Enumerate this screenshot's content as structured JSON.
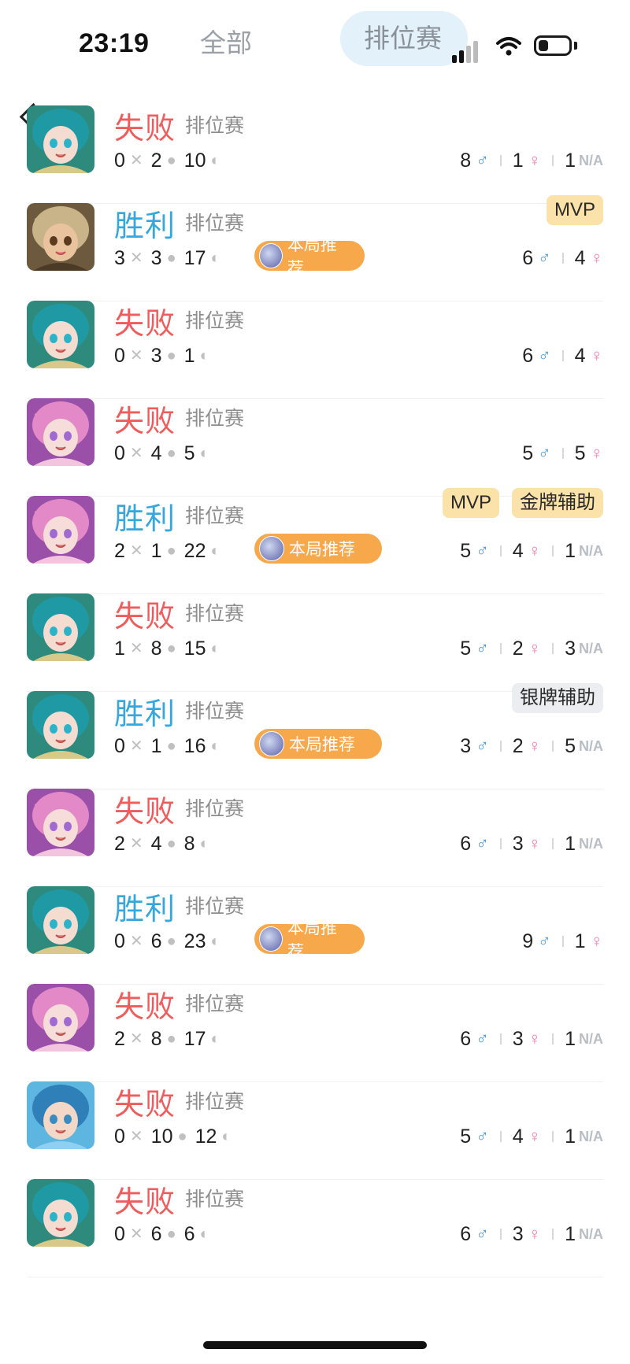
{
  "status_bar": {
    "time": "23:19"
  },
  "tabs": {
    "all": "全部",
    "ranked": "排位赛"
  },
  "colors": {
    "lose": "#ef5c5c",
    "win": "#35a7df",
    "recommend": "#f7a84a",
    "male": "#4a9ae0",
    "female": "#f07aa8"
  },
  "matches": [
    {
      "result": "失败",
      "mode": "排位赛",
      "kills": "0",
      "deaths": "2",
      "assists": "10",
      "male": "8",
      "female": "1",
      "na": "1",
      "badges": [],
      "recommend": ""
    },
    {
      "result": "胜利",
      "mode": "排位赛",
      "kills": "3",
      "deaths": "3",
      "assists": "17",
      "male": "6",
      "female": "4",
      "na": "",
      "badges": [
        "MVP"
      ],
      "recommend": "本局推荐"
    },
    {
      "result": "失败",
      "mode": "排位赛",
      "kills": "0",
      "deaths": "3",
      "assists": "1",
      "male": "6",
      "female": "4",
      "na": "",
      "badges": [],
      "recommend": ""
    },
    {
      "result": "失败",
      "mode": "排位赛",
      "kills": "0",
      "deaths": "4",
      "assists": "5",
      "male": "5",
      "female": "5",
      "na": "",
      "badges": [],
      "recommend": ""
    },
    {
      "result": "胜利",
      "mode": "排位赛",
      "kills": "2",
      "deaths": "1",
      "assists": "22",
      "male": "5",
      "female": "4",
      "na": "1",
      "badges": [
        "MVP",
        "金牌辅助"
      ],
      "recommend": "本局推荐"
    },
    {
      "result": "失败",
      "mode": "排位赛",
      "kills": "1",
      "deaths": "8",
      "assists": "15",
      "male": "5",
      "female": "2",
      "na": "3",
      "badges": [],
      "recommend": ""
    },
    {
      "result": "胜利",
      "mode": "排位赛",
      "kills": "0",
      "deaths": "1",
      "assists": "16",
      "male": "3",
      "female": "2",
      "na": "5",
      "badges": [
        "银牌辅助"
      ],
      "recommend": "本局推荐"
    },
    {
      "result": "失败",
      "mode": "排位赛",
      "kills": "2",
      "deaths": "4",
      "assists": "8",
      "male": "6",
      "female": "3",
      "na": "1",
      "badges": [],
      "recommend": ""
    },
    {
      "result": "胜利",
      "mode": "排位赛",
      "kills": "0",
      "deaths": "6",
      "assists": "23",
      "male": "9",
      "female": "1",
      "na": "",
      "badges": [],
      "recommend": "本局推荐"
    },
    {
      "result": "失败",
      "mode": "排位赛",
      "kills": "2",
      "deaths": "8",
      "assists": "17",
      "male": "6",
      "female": "3",
      "na": "1",
      "badges": [],
      "recommend": ""
    },
    {
      "result": "失败",
      "mode": "排位赛",
      "kills": "0",
      "deaths": "10",
      "assists": "12",
      "male": "5",
      "female": "4",
      "na": "1",
      "badges": [],
      "recommend": ""
    },
    {
      "result": "失败",
      "mode": "排位赛",
      "kills": "0",
      "deaths": "6",
      "assists": "6",
      "male": "6",
      "female": "3",
      "na": "1",
      "badges": [],
      "recommend": ""
    }
  ],
  "labels": {
    "na": "N/A"
  }
}
